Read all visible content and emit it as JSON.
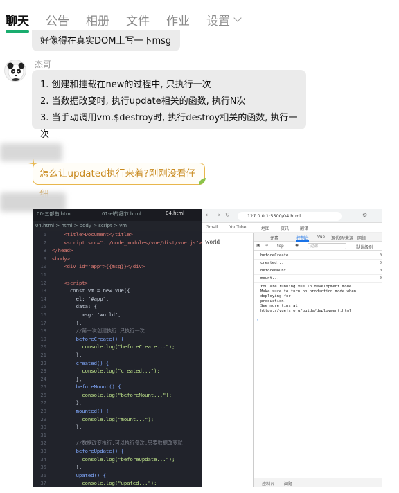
{
  "tabs": {
    "items": [
      {
        "label": "聊天",
        "active": true
      },
      {
        "label": "公告",
        "active": false
      },
      {
        "label": "相册",
        "active": false
      },
      {
        "label": "文件",
        "active": false
      },
      {
        "label": "作业",
        "active": false
      },
      {
        "label": "设置",
        "active": false
      }
    ],
    "settings_icon": "chevron-down-icon"
  },
  "messages": {
    "m1": {
      "text": "好像得在真实DOM上写一下msg"
    },
    "m2": {
      "sender": "杰哥",
      "lines": [
        "1. 创建和挂载在new的过程中, 只执行一次",
        "2. 当数据改变时, 执行update相关的函数, 执行N次",
        "3. 当手动调用vm.$destroy时, 执行destroy相关的函数, 执行一次"
      ]
    },
    "m3": {
      "text": "怎么让updated执行来着?刚刚没看仔细"
    }
  },
  "screenshot": {
    "editor": {
      "tabs": [
        "00-三部曲.html",
        "01-el的细节.html",
        "04.html"
      ],
      "breadcrumb": "04.html > html > body > script > vm",
      "lines": [
        {
          "n": "6",
          "t": "    <title>Document</title>"
        },
        {
          "n": "7",
          "t": "    <script src=\"../node_modules/vue/dist/vue.js\">"
        },
        {
          "n": "8",
          "t": "</head>"
        },
        {
          "n": "9",
          "t": "<body>"
        },
        {
          "n": "10",
          "t": "    <div id=\"app\">{{msg}}</div>"
        },
        {
          "n": "11",
          "t": ""
        },
        {
          "n": "12",
          "t": "    <script>"
        },
        {
          "n": "13",
          "t": "      const vm = new Vue({"
        },
        {
          "n": "14",
          "t": "        el: \"#app\","
        },
        {
          "n": "15",
          "t": "        data: {"
        },
        {
          "n": "16",
          "t": "          msg: \"world\","
        },
        {
          "n": "17",
          "t": "        },"
        },
        {
          "n": "18",
          "t": "        //第一次创建执行,只执行一次"
        },
        {
          "n": "19",
          "t": "        beforeCreate() {"
        },
        {
          "n": "20",
          "t": "          console.log(\"beforeCreate...\");"
        },
        {
          "n": "21",
          "t": "        },"
        },
        {
          "n": "22",
          "t": "        created() {"
        },
        {
          "n": "23",
          "t": "          console.log(\"created...\");"
        },
        {
          "n": "24",
          "t": "        },"
        },
        {
          "n": "25",
          "t": "        beforeMount() {"
        },
        {
          "n": "26",
          "t": "          console.log(\"beforeMount...\");"
        },
        {
          "n": "27",
          "t": "        },"
        },
        {
          "n": "28",
          "t": "        mounted() {"
        },
        {
          "n": "29",
          "t": "          console.log(\"mount...\");"
        },
        {
          "n": "30",
          "t": "        },"
        },
        {
          "n": "31",
          "t": ""
        },
        {
          "n": "32",
          "t": "        //数据改变执行,可以执行多次,只要数据改变就"
        },
        {
          "n": "33",
          "t": "        beforeUpdate() {"
        },
        {
          "n": "34",
          "t": "          console.log(\"beforeUpdate...\");"
        },
        {
          "n": "35",
          "t": "        },"
        },
        {
          "n": "36",
          "t": "        upated() {"
        },
        {
          "n": "37",
          "t": "          console.log(\"upated...\");"
        }
      ]
    },
    "browser": {
      "url": "127.0.0.1:5500/04.html",
      "bookmarks": [
        "Gmail",
        "YouTube",
        "地图",
        "资讯",
        "翻译"
      ],
      "page_text": "world",
      "devtools_tabs": [
        "元素",
        "控制台",
        "Vue",
        "源代码/来源",
        "网络"
      ],
      "context": "top",
      "filter_placeholder": "过滤",
      "levels": "默认级别",
      "logs": [
        "beforeCreate...",
        "created...",
        "beforeMount...",
        "mount..."
      ],
      "info_lines": [
        "You are running Vue in development mode.",
        "Make sure to turn on production mode when deploying for",
        "production.",
        "See more tips at https://vuejs.org/guide/deployment.html"
      ],
      "bottom_tabs": [
        "控制台",
        "问题"
      ]
    }
  }
}
